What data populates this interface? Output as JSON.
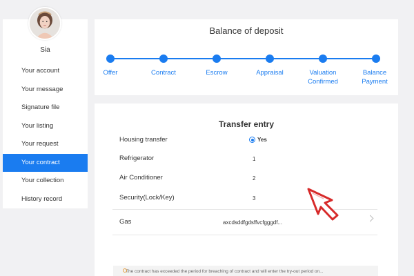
{
  "sidebar": {
    "username": "Sia",
    "items": [
      {
        "label": "Your account"
      },
      {
        "label": "Your message"
      },
      {
        "label": "Signature file"
      },
      {
        "label": "Your listing"
      },
      {
        "label": "Your request"
      },
      {
        "label": "Your contract",
        "active": true
      },
      {
        "label": "Your collection"
      },
      {
        "label": "History record"
      }
    ]
  },
  "progress": {
    "title": "Balance of deposit",
    "steps": [
      "Offer",
      "Contract",
      "Escrow",
      "Appraisal",
      "Valuation Confirmed",
      "Balance Payment"
    ],
    "accent_color": "#1a7cf0"
  },
  "transfer": {
    "title": "Transfer entry",
    "rows": [
      {
        "label": "Housing transfer",
        "value": "Yes"
      },
      {
        "label": "Refrigerator",
        "value": "1"
      },
      {
        "label": "Air Conditioner",
        "value": "2"
      },
      {
        "label": "Security(Lock/Key)",
        "value": "3"
      },
      {
        "label": "Gas",
        "value": "axcdsddfgdsffvcfgggdf..."
      }
    ],
    "notice": "The contract has exceeded the period for breaching of contract and will enter the try-out period on..."
  },
  "icons": {
    "cursor": "hand-pointer-arrow-icon",
    "chevron": "chevron-right-icon",
    "radio": "radio-selected-icon"
  }
}
